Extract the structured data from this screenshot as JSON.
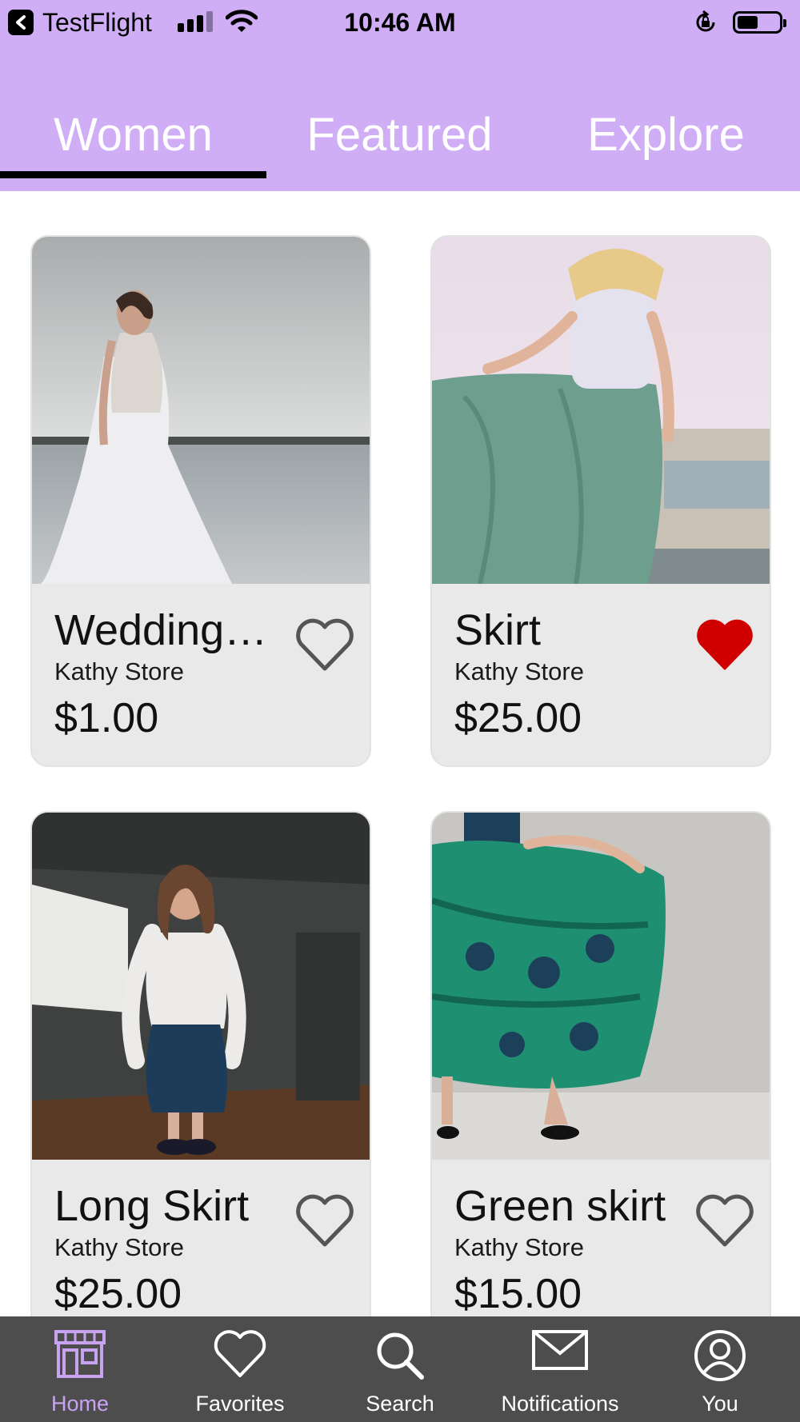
{
  "status_bar": {
    "back_app": "TestFlight",
    "time": "10:46 AM",
    "battery_level": 0.5
  },
  "tabs": [
    {
      "label": "Women",
      "selected": true
    },
    {
      "label": "Featured",
      "selected": false
    },
    {
      "label": "Explore",
      "selected": false
    }
  ],
  "products": [
    {
      "title": "Wedding…",
      "store": "Kathy Store",
      "price": "$1.00",
      "favorited": false,
      "image": "wedding-dress-photo"
    },
    {
      "title": "Skirt",
      "store": "Kathy Store",
      "price": "$25.00",
      "favorited": true,
      "image": "teal-skirt-photo"
    },
    {
      "title": "Long Skirt",
      "store": "Kathy Store",
      "price": "$25.00",
      "favorited": false,
      "image": "navy-long-skirt-photo"
    },
    {
      "title": "Green skirt",
      "store": "Kathy Store",
      "price": "$15.00",
      "favorited": false,
      "image": "green-skirt-photo"
    }
  ],
  "bottom_nav": [
    {
      "label": "Home",
      "icon": "storefront-icon",
      "active": true
    },
    {
      "label": "Favorites",
      "icon": "heart-icon",
      "active": false
    },
    {
      "label": "Search",
      "icon": "search-icon",
      "active": false
    },
    {
      "label": "Notifications",
      "icon": "envelope-icon",
      "active": false
    },
    {
      "label": "You",
      "icon": "user-icon",
      "active": false
    }
  ],
  "colors": {
    "header_bg": "#d0aef6",
    "tab_indicator": "#000000",
    "favorite_red": "#d10000",
    "tabbar_bg": "#4d4d4d",
    "tabbar_active": "#c9a3f2"
  }
}
